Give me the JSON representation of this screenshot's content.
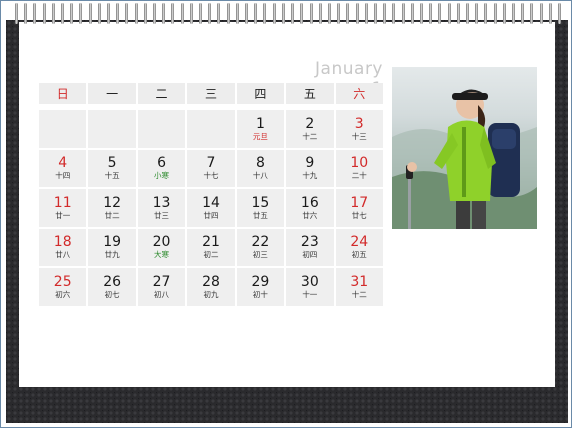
{
  "calendar": {
    "month_title": "January 1",
    "weekdays": [
      {
        "label": "日",
        "weekend": true
      },
      {
        "label": "一",
        "weekend": false
      },
      {
        "label": "二",
        "weekend": false
      },
      {
        "label": "三",
        "weekend": false
      },
      {
        "label": "四",
        "weekend": false
      },
      {
        "label": "五",
        "weekend": false
      },
      {
        "label": "六",
        "weekend": true
      }
    ],
    "weeks": [
      [
        {
          "day": "",
          "lunar": ""
        },
        {
          "day": "",
          "lunar": ""
        },
        {
          "day": "",
          "lunar": ""
        },
        {
          "day": "",
          "lunar": ""
        },
        {
          "day": "1",
          "lunar": "元旦",
          "kind": "holiday"
        },
        {
          "day": "2",
          "lunar": "十二"
        },
        {
          "day": "3",
          "lunar": "十三",
          "weekend": true
        }
      ],
      [
        {
          "day": "4",
          "lunar": "十四",
          "weekend": true
        },
        {
          "day": "5",
          "lunar": "十五"
        },
        {
          "day": "6",
          "lunar": "小寒",
          "kind": "term"
        },
        {
          "day": "7",
          "lunar": "十七"
        },
        {
          "day": "8",
          "lunar": "十八"
        },
        {
          "day": "9",
          "lunar": "十九"
        },
        {
          "day": "10",
          "lunar": "二十",
          "weekend": true
        }
      ],
      [
        {
          "day": "11",
          "lunar": "廿一",
          "weekend": true
        },
        {
          "day": "12",
          "lunar": "廿二"
        },
        {
          "day": "13",
          "lunar": "廿三"
        },
        {
          "day": "14",
          "lunar": "廿四"
        },
        {
          "day": "15",
          "lunar": "廿五"
        },
        {
          "day": "16",
          "lunar": "廿六"
        },
        {
          "day": "17",
          "lunar": "廿七",
          "weekend": true
        }
      ],
      [
        {
          "day": "18",
          "lunar": "廿八",
          "weekend": true
        },
        {
          "day": "19",
          "lunar": "廿九"
        },
        {
          "day": "20",
          "lunar": "大寒",
          "kind": "term"
        },
        {
          "day": "21",
          "lunar": "初二"
        },
        {
          "day": "22",
          "lunar": "初三"
        },
        {
          "day": "23",
          "lunar": "初四"
        },
        {
          "day": "24",
          "lunar": "初五",
          "weekend": true
        }
      ],
      [
        {
          "day": "25",
          "lunar": "初六",
          "weekend": true
        },
        {
          "day": "26",
          "lunar": "初七"
        },
        {
          "day": "27",
          "lunar": "初八"
        },
        {
          "day": "28",
          "lunar": "初九"
        },
        {
          "day": "29",
          "lunar": "初十"
        },
        {
          "day": "30",
          "lunar": "十一"
        },
        {
          "day": "31",
          "lunar": "十二",
          "weekend": true
        }
      ]
    ]
  },
  "colors": {
    "weekend_red": "#d22a2a",
    "solar_term_green": "#2c8a2c",
    "cell_bg": "#efefef",
    "base_dark": "#2a2a2d"
  },
  "photo": {
    "subject": "hiker-woman-with-trekking-pole"
  }
}
